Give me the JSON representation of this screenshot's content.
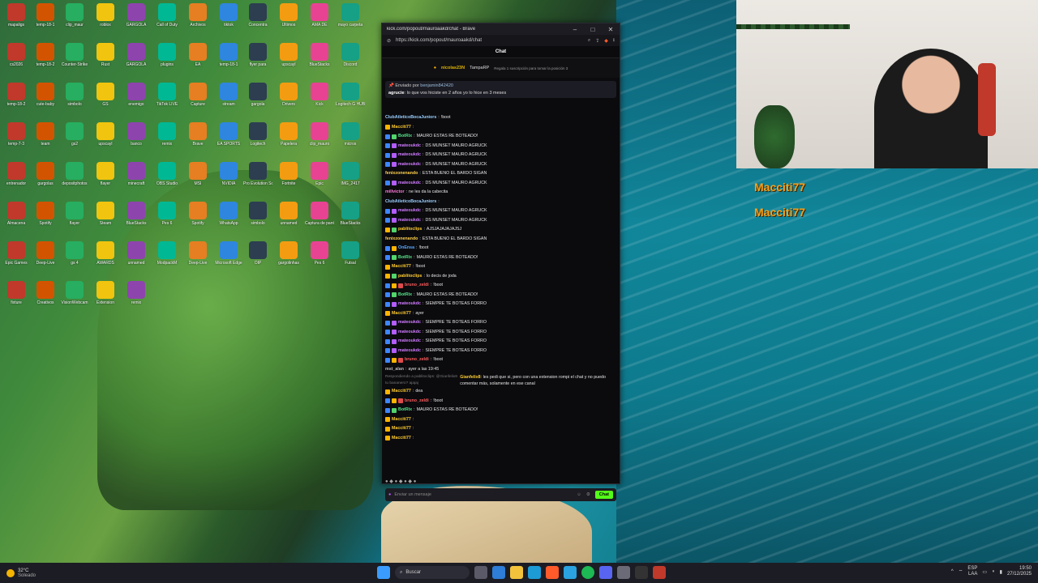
{
  "desktop": {
    "icons": [
      {
        "label": "mapaligs"
      },
      {
        "label": "temp-18-1"
      },
      {
        "label": "clip_maur"
      },
      {
        "label": "roblox"
      },
      {
        "label": "GARGOLA"
      },
      {
        "label": "Call of Duty"
      },
      {
        "label": "Archivos"
      },
      {
        "label": "tiktok"
      },
      {
        "label": "Concentra"
      },
      {
        "label": "Ultimos"
      },
      {
        "label": "AMA DE"
      },
      {
        "label": "mayo carpeta"
      },
      {
        "label": "cs2026"
      },
      {
        "label": "temp-18-2"
      },
      {
        "label": "Counter-Strike"
      },
      {
        "label": "Rust"
      },
      {
        "label": "GARGOLA"
      },
      {
        "label": "plugins"
      },
      {
        "label": "EA"
      },
      {
        "label": "temp-18-1"
      },
      {
        "label": "flyer para"
      },
      {
        "label": "upscayl"
      },
      {
        "label": "BlueStacks"
      },
      {
        "label": "Discord"
      },
      {
        "label": "temp-18-2"
      },
      {
        "label": "cute-baby"
      },
      {
        "label": "simbolo"
      },
      {
        "label": "GS"
      },
      {
        "label": "enemigo"
      },
      {
        "label": "TikTok LIVE"
      },
      {
        "label": "Capture"
      },
      {
        "label": "stream"
      },
      {
        "label": "gargola"
      },
      {
        "label": "Drivers"
      },
      {
        "label": "Kick"
      },
      {
        "label": "Logitech G HUB"
      },
      {
        "label": "temp-7-3"
      },
      {
        "label": "team"
      },
      {
        "label": "gs2"
      },
      {
        "label": "upscayl"
      },
      {
        "label": "banco"
      },
      {
        "label": "remix"
      },
      {
        "label": "Brave"
      },
      {
        "label": "EA SPORTS"
      },
      {
        "label": "Logitech"
      },
      {
        "label": "Papelera"
      },
      {
        "label": "clip_mauro"
      },
      {
        "label": "micros"
      },
      {
        "label": "entrenador"
      },
      {
        "label": "gargolas"
      },
      {
        "label": "depositphotos"
      },
      {
        "label": "flayer"
      },
      {
        "label": "minecraft"
      },
      {
        "label": "OBS Studio"
      },
      {
        "label": "MSI"
      },
      {
        "label": "NVIDIA"
      },
      {
        "label": "Pro Evolution Soccer"
      },
      {
        "label": "Fortnite"
      },
      {
        "label": "Epic"
      },
      {
        "label": "IMG_2417"
      },
      {
        "label": "Almacena"
      },
      {
        "label": "Spotify"
      },
      {
        "label": "flayer"
      },
      {
        "label": "Steam"
      },
      {
        "label": "BlueStacks"
      },
      {
        "label": "Pes 6"
      },
      {
        "label": "Spotify"
      },
      {
        "label": "WhatsApp"
      },
      {
        "label": "simbolo"
      },
      {
        "label": "unnamed"
      },
      {
        "label": "Captura de pantalla"
      },
      {
        "label": "BlueStacks"
      },
      {
        "label": "Epic Games"
      },
      {
        "label": "Deep-Live"
      },
      {
        "label": "gs 4"
      },
      {
        "label": "AWARDS"
      },
      {
        "label": "unnamed"
      },
      {
        "label": "ModpackM"
      },
      {
        "label": "Deep-Live"
      },
      {
        "label": "Microsoft Edge"
      },
      {
        "label": "OIP"
      },
      {
        "label": "gargolinhas"
      },
      {
        "label": "Pes 6"
      },
      {
        "label": "Futsal"
      },
      {
        "label": "fixture"
      },
      {
        "label": "Creativos"
      },
      {
        "label": "VisionWebcam"
      },
      {
        "label": "Extension"
      },
      {
        "label": "remix"
      }
    ]
  },
  "browser": {
    "title": "kick.com/popout/mauroaakd/chat - Brave",
    "url": "https://kick.com/popout/mauroaakd/chat",
    "chat_header": "Chat",
    "gift": {
      "user1": "nicolas23N",
      "user2": "TampaRP",
      "sub": "Regala 1 suscripción para tomar la posición 3"
    },
    "pinned": {
      "header": "Enviado por",
      "sender": "benjamin842420",
      "author": "agrucie",
      "text": "lo que vos hiciste en 2 años yo lo hice en 3 meses"
    },
    "messages": [
      {
        "user": "ClubAtleticoBocaJuniors",
        "color": "#9bd0ff",
        "text": "!boot",
        "b": []
      },
      {
        "user": "Macciti77",
        "color": "#ffcc33",
        "text": "",
        "b": [
          "b4"
        ]
      },
      {
        "user": "BotRix",
        "color": "#57e389",
        "text": "MAURO ESTAS RE BOTEADO!",
        "b": [
          "b1",
          "b2"
        ]
      },
      {
        "user": "mateoukdc",
        "color": "#d07aff",
        "text": "DS MUNSET MAURO AGRUCK",
        "b": [
          "b1",
          "b3"
        ]
      },
      {
        "user": "mateoukdc",
        "color": "#d07aff",
        "text": "DS MUNSET MAURO AGRUCK",
        "b": [
          "b1",
          "b3"
        ]
      },
      {
        "user": "mateoukdc",
        "color": "#d07aff",
        "text": "DS MUNSET MAURO AGRUCK",
        "b": [
          "b1",
          "b3"
        ]
      },
      {
        "user": "fenixzonenando",
        "color": "#ffd24d",
        "text": "ESTA BUENO EL BARDO SIGAN",
        "b": []
      },
      {
        "user": "mateoukdc",
        "color": "#d07aff",
        "text": "DS MUNSET MAURO AGRUCK",
        "b": [
          "b1",
          "b3"
        ]
      },
      {
        "user": "millvictor",
        "color": "#ff7ad9",
        "text": "ne les da la cabecita",
        "b": []
      },
      {
        "user": "ClubAtleticoBocaJuniors",
        "color": "#9bd0ff",
        "text": "",
        "b": []
      },
      {
        "user": "mateoukdc",
        "color": "#d07aff",
        "text": "DS MUNSET MAURO AGRUCK",
        "b": [
          "b1",
          "b3"
        ]
      },
      {
        "user": "mateoukdc",
        "color": "#d07aff",
        "text": "DS MUNSET MAURO AGRUCK",
        "b": [
          "b1",
          "b3"
        ]
      },
      {
        "user": "pablitoclips",
        "color": "#ffcc33",
        "text": "AJSJAJAJAJAJSJ",
        "b": [
          "b4",
          "b2"
        ]
      },
      {
        "user": "fenixzonenando",
        "color": "#ffd24d",
        "text": "ESTA BUENO EL BARDO SIGAN",
        "b": []
      },
      {
        "user": "OnEnsa",
        "color": "#5aa9ff",
        "text": "!boot",
        "b": [
          "b1",
          "b4"
        ]
      },
      {
        "user": "BotRix",
        "color": "#57e389",
        "text": "MAURO ESTAS RE BOTEADO!",
        "b": [
          "b1",
          "b2"
        ]
      },
      {
        "user": "Macciti77",
        "color": "#ffcc33",
        "text": "!boot",
        "b": [
          "b4"
        ]
      },
      {
        "user": "pablitoclips",
        "color": "#ffcc33",
        "text": "lo decis de joda",
        "b": [
          "b4",
          "b2"
        ]
      },
      {
        "user": "bruno_zeldi",
        "color": "#ff5b5b",
        "text": "!boot",
        "b": [
          "b1",
          "b4",
          "b5"
        ]
      },
      {
        "user": "BotRix",
        "color": "#57e389",
        "text": "MAURO ESTAS RE BOTEADO!",
        "b": [
          "b1",
          "b2"
        ]
      },
      {
        "user": "mateoukdc",
        "color": "#d07aff",
        "text": "SIEMPRE TE BOTEAS FORRO",
        "b": [
          "b1",
          "b3"
        ]
      },
      {
        "user": "Macciti77",
        "color": "#ffcc33",
        "text": "ayer",
        "b": [
          "b4"
        ]
      },
      {
        "user": "mateoukdc",
        "color": "#d07aff",
        "text": "SIEMPRE TE BOTEAS FORRO",
        "b": [
          "b1",
          "b3"
        ]
      },
      {
        "user": "mateoukdc",
        "color": "#d07aff",
        "text": "SIEMPRE TE BOTEAS FORRO",
        "b": [
          "b1",
          "b3"
        ]
      },
      {
        "user": "mateoukdc",
        "color": "#d07aff",
        "text": "SIEMPRE TE BOTEAS FORRO",
        "b": [
          "b1",
          "b3"
        ]
      },
      {
        "user": "mateoukdc",
        "color": "#d07aff",
        "text": "SIEMPRE TE BOTEAS FORRO",
        "b": [
          "b1",
          "b3"
        ]
      },
      {
        "user": "bruno_zeldi",
        "color": "#ff5b5b",
        "text": "!boot",
        "b": [
          "b1",
          "b4",
          "b5"
        ]
      },
      {
        "user": "mst_alan",
        "color": "#bbbbbb",
        "text": "ayer a las 19:45",
        "b": []
      }
    ],
    "reply": {
      "head": "Respondiendo a pablitoclips: @Gianfelix8 tu bananero? ajajaj",
      "user": "Gianfelix8",
      "text": "les pedi que si, pero con una extension rompi el chat y no puedo comentar más, solamente en ese canal"
    },
    "messages2": [
      {
        "user": "Macciti77",
        "color": "#ffcc33",
        "text": "dea",
        "b": [
          "b4"
        ]
      },
      {
        "user": "bruno_zeldi",
        "color": "#ff5b5b",
        "text": "!boot",
        "b": [
          "b1",
          "b4",
          "b5"
        ]
      },
      {
        "user": "BotRix",
        "color": "#57e389",
        "text": "MAURO ESTAS RE BOTEADO!",
        "b": [
          "b1",
          "b2"
        ]
      },
      {
        "user": "Macciti77",
        "color": "#ffcc33",
        "text": "",
        "b": [
          "b4"
        ]
      },
      {
        "user": "Macciti77",
        "color": "#ffcc33",
        "text": "",
        "b": [
          "b4"
        ]
      },
      {
        "user": "Macciti77",
        "color": "#ffcc33",
        "text": "",
        "b": [
          "b4"
        ]
      }
    ],
    "input_placeholder": "Enviar un mensaje",
    "chat_button": "Chat"
  },
  "overlay": {
    "lines": [
      "Macciti77",
      "Macciti77"
    ]
  },
  "taskbar": {
    "temp": "32°C",
    "weather": "Soleado",
    "search": "Buscar",
    "lang": "ESP",
    "lang2": "LAA",
    "time": "19:50",
    "date": "27/12/2025"
  }
}
